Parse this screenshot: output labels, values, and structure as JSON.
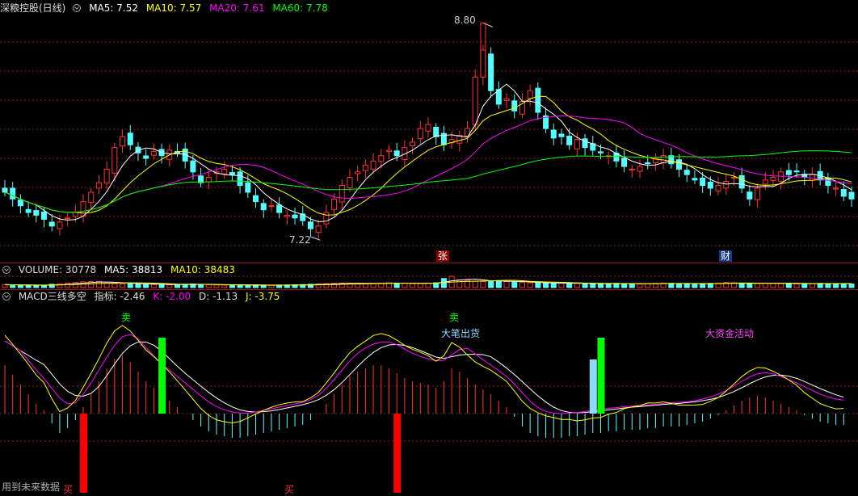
{
  "header": {
    "title": "深粮控股(日线)",
    "ma5": "MA5: 7.52",
    "ma10": "MA10: 7.57",
    "ma20": "MA20: 7.61",
    "ma60": "MA60: 7.78"
  },
  "price_marks": {
    "high": "8.80",
    "low": "7.22",
    "tag_zhang": "张",
    "tag_cai": "财"
  },
  "volume_header": {
    "volume": "VOLUME: 30778",
    "ma5": "MA5: 38813",
    "ma10": "MA10: 38483"
  },
  "macd_header": {
    "name": "MACD三线多空",
    "indicator": "指标: -2.46",
    "k": "K: -2.00",
    "d": "D: -1.13",
    "j": "J: -3.75"
  },
  "signals": {
    "sell1": "卖",
    "sell2": "卖",
    "buy1": "买",
    "buy2": "买",
    "big_sell": "大笔出货",
    "capital": "大资金活动"
  },
  "footer": "用到未来数据",
  "colors": {
    "up": "#ff3232",
    "down": "#54ffff",
    "ma5": "#ffffff",
    "ma10": "#ffff00",
    "ma20": "#ff00ff",
    "ma60": "#00ff00",
    "grid": "#8b1a1a"
  },
  "chart_data": {
    "type": "candlestick",
    "title": "深粮控股(日线)",
    "ylim": [
      7.15,
      8.85
    ],
    "high_mark": 8.8,
    "low_mark": 7.22,
    "ma_latest": {
      "MA5": 7.52,
      "MA10": 7.57,
      "MA20": 7.61,
      "MA60": 7.78
    },
    "volume_latest": {
      "VOLUME": 30778,
      "MA5": 38813,
      "MA10": 38483
    },
    "macd_latest": {
      "indicator": -2.46,
      "K": -2.0,
      "D": -1.13,
      "J": -3.75
    },
    "close": [
      7.55,
      7.5,
      7.45,
      7.4,
      7.38,
      7.35,
      7.3,
      7.33,
      7.36,
      7.4,
      7.48,
      7.55,
      7.62,
      7.72,
      7.88,
      7.96,
      7.9,
      7.84,
      7.8,
      7.85,
      7.82,
      7.86,
      7.84,
      7.78,
      7.7,
      7.62,
      7.66,
      7.7,
      7.72,
      7.68,
      7.6,
      7.55,
      7.48,
      7.42,
      7.45,
      7.4,
      7.38,
      7.36,
      7.34,
      7.28,
      7.3,
      7.4,
      7.5,
      7.6,
      7.66,
      7.7,
      7.75,
      7.78,
      7.82,
      7.86,
      7.82,
      7.88,
      7.92,
      8.02,
      8.05,
      7.96,
      7.9,
      7.94,
      7.97,
      8.02,
      8.4,
      8.6,
      8.3,
      8.2,
      8.24,
      8.15,
      8.22,
      8.3,
      8.14,
      8.02,
      7.95,
      7.96,
      7.9,
      7.94,
      7.88,
      7.86,
      7.84,
      7.82,
      7.78,
      7.74,
      7.72,
      7.74,
      7.76,
      7.8,
      7.82,
      7.76,
      7.72,
      7.68,
      7.64,
      7.6,
      7.58,
      7.6,
      7.63,
      7.66,
      7.58,
      7.5,
      7.58,
      7.64,
      7.66,
      7.7,
      7.68,
      7.7,
      7.66,
      7.68,
      7.64,
      7.6,
      7.58,
      7.52,
      7.5
    ],
    "volume": [
      20,
      18,
      16,
      15,
      14,
      16,
      22,
      25,
      30,
      34,
      38,
      40,
      42,
      30,
      26,
      24,
      28,
      24,
      22,
      20,
      19,
      18,
      20,
      22,
      24,
      21,
      19,
      17,
      16,
      18,
      17,
      16,
      15,
      14,
      16,
      17,
      18,
      19,
      20,
      22,
      24,
      26,
      28,
      30,
      29,
      27,
      26,
      28,
      30,
      32,
      30,
      28,
      26,
      28,
      30,
      32,
      60,
      75,
      52,
      48,
      42,
      40,
      44,
      46,
      40,
      36,
      34,
      32,
      30,
      29,
      28,
      30,
      29,
      28,
      26,
      25,
      24,
      26,
      28,
      27,
      25,
      24,
      26,
      28,
      30,
      28,
      26,
      25,
      24,
      26,
      28,
      30,
      34,
      32,
      28,
      26,
      28,
      30,
      29,
      28,
      26,
      25,
      24,
      26,
      28,
      27,
      26,
      25,
      24
    ],
    "macd_hist": [
      3,
      2.4,
      1.8,
      1.2,
      0.6,
      0.2,
      -0.6,
      -1.2,
      -0.9,
      -0.4,
      0.4,
      1.2,
      2.0,
      2.8,
      3.4,
      3.6,
      3.2,
      2.6,
      2.0,
      1.6,
      1.2,
      0.8,
      0.4,
      0,
      -0.4,
      -0.8,
      -1.1,
      -1.3,
      -1.4,
      -1.5,
      -1.5,
      -1.4,
      -1.3,
      -1.2,
      -1.1,
      -1.0,
      -0.9,
      -0.8,
      -0.7,
      -0.4,
      0,
      0.6,
      1.2,
      1.8,
      2.3,
      2.6,
      2.8,
      3.0,
      3.0,
      2.8,
      2.5,
      2.2,
      2.0,
      1.9,
      1.8,
      1.6,
      2.0,
      2.8,
      2.6,
      2.2,
      1.8,
      1.5,
      1.2,
      0.8,
      0.4,
      -0.2,
      -0.8,
      -1.2,
      -1.4,
      -1.5,
      -1.5,
      -1.5,
      -1.4,
      -1.4,
      -1.3,
      -1.2,
      -1.2,
      -1.1,
      -1.1,
      -1.0,
      -1.0,
      -1.0,
      -0.9,
      -0.9,
      -0.8,
      -0.8,
      -0.8,
      -0.7,
      -0.6,
      -0.5,
      -0.3,
      -0.1,
      0.2,
      0.5,
      0.8,
      1.0,
      1.1,
      1.0,
      0.8,
      0.6,
      0.4,
      0.2,
      -0.1,
      -0.3,
      -0.5,
      -0.6,
      -0.7,
      -0.7
    ],
    "signals_at": {
      "sell": [
        20,
        76
      ],
      "buy": [
        10,
        50
      ],
      "big_sell": 75
    }
  }
}
